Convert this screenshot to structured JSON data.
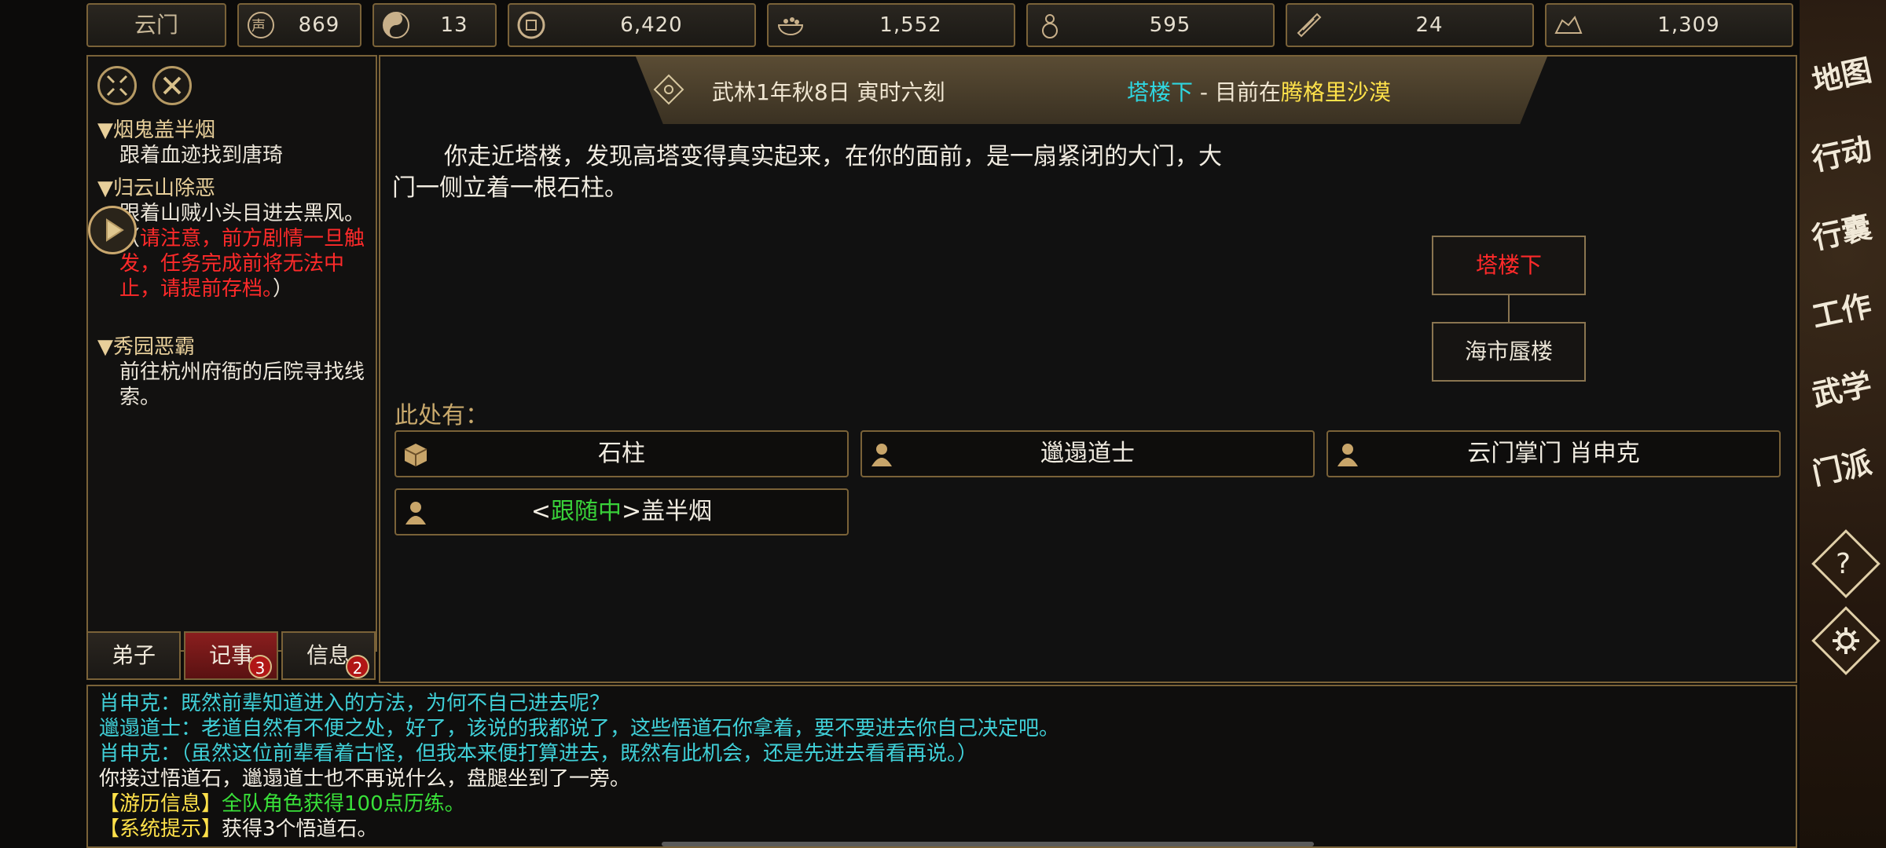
{
  "topbar": {
    "sect": "云门",
    "resources": [
      {
        "icon": "reputation-icon",
        "value": "869"
      },
      {
        "icon": "yin-yang-icon",
        "value": "13"
      },
      {
        "icon": "coin-icon",
        "value": "6,420"
      },
      {
        "icon": "food-bowl-icon",
        "value": "1,552"
      },
      {
        "icon": "gourd-icon",
        "value": "595"
      },
      {
        "icon": "scroll-icon",
        "value": "24"
      },
      {
        "icon": "ore-icon",
        "value": "1,309"
      }
    ]
  },
  "quests": [
    {
      "title": "▼烟鬼盖半烟",
      "desc": "跟着血迹找到唐琦"
    },
    {
      "title": "▼归云山除恶",
      "desc": "跟着山贼小头目进去黑风",
      "desc2": "。（",
      "warning": "请注意，前方剧情一旦触发，任务完成前将无法中止，请提前存档。",
      "desc3": "）"
    },
    {
      "title": "▼秀园恶霸",
      "desc": "前往杭州府衙的后院寻找线索。"
    }
  ],
  "tabs": [
    {
      "label": "弟子"
    },
    {
      "label": "记事",
      "badge": "3"
    },
    {
      "label": "信息",
      "badge": "2"
    }
  ],
  "header": {
    "date": "武林1年秋8日 寅时六刻",
    "location": "塔楼下",
    "separator": " - 目前在",
    "region": "腾格里沙漠"
  },
  "narrative": "你走近塔楼，发现高塔变得真实起来，在你的面前，是一扇紧闭的大门，大门一侧立着一根石柱。",
  "map": {
    "current": "塔楼下",
    "below": "海市蜃楼"
  },
  "here_label": "此处有：",
  "entities": [
    {
      "icon": "box-icon",
      "label": "石柱"
    },
    {
      "icon": "person-icon",
      "label": "邋遢道士"
    },
    {
      "icon": "person-icon",
      "label": "云门掌门 肖申克"
    },
    {
      "icon": "person-icon",
      "prefix": "<",
      "status": "跟随中",
      "suffix": ">盖半烟"
    }
  ],
  "log": [
    {
      "text": "肖申克：既然前辈知道进入的方法，为何不自己进去呢？"
    },
    {
      "text": "邋遢道士：老道自然有不便之处，好了，该说的我都说了，这些悟道石你拿着，要不要进去你自己决定吧。"
    },
    {
      "text": "肖申克：（虽然这位前辈看着古怪，但我本来便打算进去，既然有此机会，还是先进去看看再说。）"
    },
    {
      "text": "你接过悟道石，邋遢道士也不再说什么，盘腿坐到了一旁。"
    },
    {
      "tag": "【游历信息】",
      "text": "全队角色获得100点历练。"
    },
    {
      "tag": "【系统提示】",
      "text": "获得3个悟道石。"
    }
  ],
  "menu": [
    "地图",
    "行动",
    "行囊",
    "工作",
    "武学",
    "门派"
  ],
  "menu_icons": [
    "help-icon",
    "settings-icon"
  ],
  "colors": {
    "gold": "#7a6238",
    "cyan": "#2fd6e0",
    "yellow": "#ffe24a",
    "red": "#ff2a2a",
    "green": "#39d139"
  }
}
